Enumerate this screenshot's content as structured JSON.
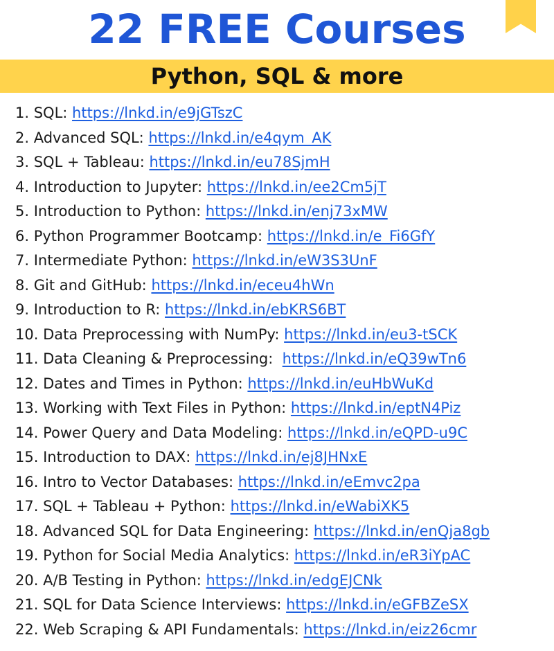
{
  "header": {
    "title": "22 FREE Courses",
    "subtitle": "Python, SQL & more"
  },
  "courses": [
    {
      "label": "1. SQL: ",
      "url": "https://lnkd.in/e9jGTszC"
    },
    {
      "label": "2. Advanced SQL: ",
      "url": "https://lnkd.in/e4qym_AK"
    },
    {
      "label": "3. SQL + Tableau: ",
      "url": "https://lnkd.in/eu78SjmH"
    },
    {
      "label": "4. Introduction to Jupyter: ",
      "url": "https://lnkd.in/ee2Cm5jT"
    },
    {
      "label": "5. Introduction to Python: ",
      "url": "https://lnkd.in/enj73xMW"
    },
    {
      "label": "6. Python Programmer Bootcamp: ",
      "url": "https://lnkd.in/e_Fi6GfY"
    },
    {
      "label": "7. Intermediate Python: ",
      "url": "https://lnkd.in/eW3S3UnF"
    },
    {
      "label": "8. Git and GitHub: ",
      "url": "https://lnkd.in/eceu4hWn"
    },
    {
      "label": "9. Introduction to R: ",
      "url": "https://lnkd.in/ebKRS6BT"
    },
    {
      "label": "10. Data Preprocessing with NumPy: ",
      "url": "https://lnkd.in/eu3-tSCK"
    },
    {
      "label": "11. Data Cleaning & Preprocessing:  ",
      "url": "https://lnkd.in/eQ39wTn6"
    },
    {
      "label": "12. Dates and Times in Python: ",
      "url": "https://lnkd.in/euHbWuKd"
    },
    {
      "label": "13. Working with Text Files in Python: ",
      "url": "https://lnkd.in/eptN4Piz"
    },
    {
      "label": "14. Power Query and Data Modeling: ",
      "url": "https://lnkd.in/eQPD-u9C"
    },
    {
      "label": "15. Introduction to DAX: ",
      "url": "https://lnkd.in/ej8JHNxE"
    },
    {
      "label": "16. Intro to Vector Databases: ",
      "url": "https://lnkd.in/eEmvc2pa"
    },
    {
      "label": "17. SQL + Tableau + Python: ",
      "url": "https://lnkd.in/eWabiXK5"
    },
    {
      "label": "18. Advanced SQL for Data Engineering: ",
      "url": "https://lnkd.in/enQja8gb"
    },
    {
      "label": "19. Python for Social Media Analytics: ",
      "url": "https://lnkd.in/eR3iYpAC"
    },
    {
      "label": "20. A/B Testing in Python: ",
      "url": "https://lnkd.in/edgEJCNk"
    },
    {
      "label": "21. SQL for Data Science Interviews: ",
      "url": "https://lnkd.in/eGFBZeSX"
    },
    {
      "label": "22. Web Scraping & API Fundamentals: ",
      "url": "https://lnkd.in/eiz26cmr"
    }
  ],
  "colors": {
    "title": "#1f56d6",
    "banner": "#ffd34c",
    "link": "#1d5fe0",
    "bookmark": "#ffd24a"
  },
  "icons": {
    "bookmark": "bookmark-icon"
  }
}
